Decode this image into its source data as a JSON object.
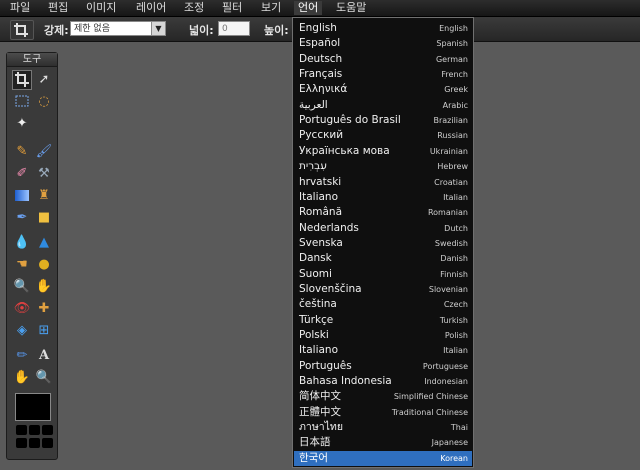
{
  "menu": {
    "items": [
      {
        "label": "파일"
      },
      {
        "label": "편집"
      },
      {
        "label": "이미지"
      },
      {
        "label": "레이어"
      },
      {
        "label": "조정"
      },
      {
        "label": "필터"
      },
      {
        "label": "보기"
      },
      {
        "label": "언어"
      },
      {
        "label": "도움말"
      }
    ],
    "active": "언어"
  },
  "options": {
    "constraint_label": "강제:",
    "constraint_value": "제한 없음",
    "width_label": "넓이:",
    "width_value": "0",
    "height_label": "높이:"
  },
  "toolbox": {
    "title": "도구",
    "icons": [
      "crop-icon",
      "move-icon",
      "marquee-icon",
      "lasso-icon",
      "magic-wand-icon",
      "pencil-icon",
      "brush-icon",
      "eraser-icon",
      "clone-stamp-icon",
      "gradient-icon",
      "stamp-icon",
      "color-replace-icon",
      "shape-icon",
      "blur-icon",
      "sharpen-icon",
      "smudge-icon",
      "sponge-icon",
      "zoom-red-eye-icon",
      "dodge-icon",
      "red-eye-icon",
      "spot-heal-icon",
      "bloat-icon",
      "pinch-icon",
      "color-picker-icon",
      "type-icon",
      "hand-icon",
      "zoom-icon"
    ],
    "foreground_color": "#000000"
  },
  "languages": [
    {
      "native": "English",
      "english": "English"
    },
    {
      "native": "Español",
      "english": "Spanish"
    },
    {
      "native": "Deutsch",
      "english": "German"
    },
    {
      "native": "Français",
      "english": "French"
    },
    {
      "native": "Ελληνικά",
      "english": "Greek"
    },
    {
      "native": "العربية",
      "english": "Arabic"
    },
    {
      "native": "Português do Brasil",
      "english": "Brazilian"
    },
    {
      "native": "Русский",
      "english": "Russian"
    },
    {
      "native": "Українська мова",
      "english": "Ukrainian"
    },
    {
      "native": "עִבְרִית",
      "english": "Hebrew"
    },
    {
      "native": "hrvatski",
      "english": "Croatian"
    },
    {
      "native": "Italiano",
      "english": "Italian"
    },
    {
      "native": "Română",
      "english": "Romanian"
    },
    {
      "native": "Nederlands",
      "english": "Dutch"
    },
    {
      "native": "Svenska",
      "english": "Swedish"
    },
    {
      "native": "Dansk",
      "english": "Danish"
    },
    {
      "native": "Suomi",
      "english": "Finnish"
    },
    {
      "native": "Slovenščina",
      "english": "Slovenian"
    },
    {
      "native": "čeština",
      "english": "Czech"
    },
    {
      "native": "Türkçe",
      "english": "Turkish"
    },
    {
      "native": "Polski",
      "english": "Polish"
    },
    {
      "native": "Italiano",
      "english": "Italian"
    },
    {
      "native": "Português",
      "english": "Portuguese"
    },
    {
      "native": "Bahasa Indonesia",
      "english": "Indonesian"
    },
    {
      "native": "简体中文",
      "english": "Simplified Chinese"
    },
    {
      "native": "正體中文",
      "english": "Traditional Chinese"
    },
    {
      "native": "ภาษาไทย",
      "english": "Thai"
    },
    {
      "native": "日本語",
      "english": "Japanese"
    },
    {
      "native": "한국어",
      "english": "Korean"
    }
  ],
  "selected_language": "한국어",
  "colors": {
    "highlight": "#2f6fbf",
    "workspace": "#5a5a5a",
    "menu_bg": "#1f1f1f"
  }
}
